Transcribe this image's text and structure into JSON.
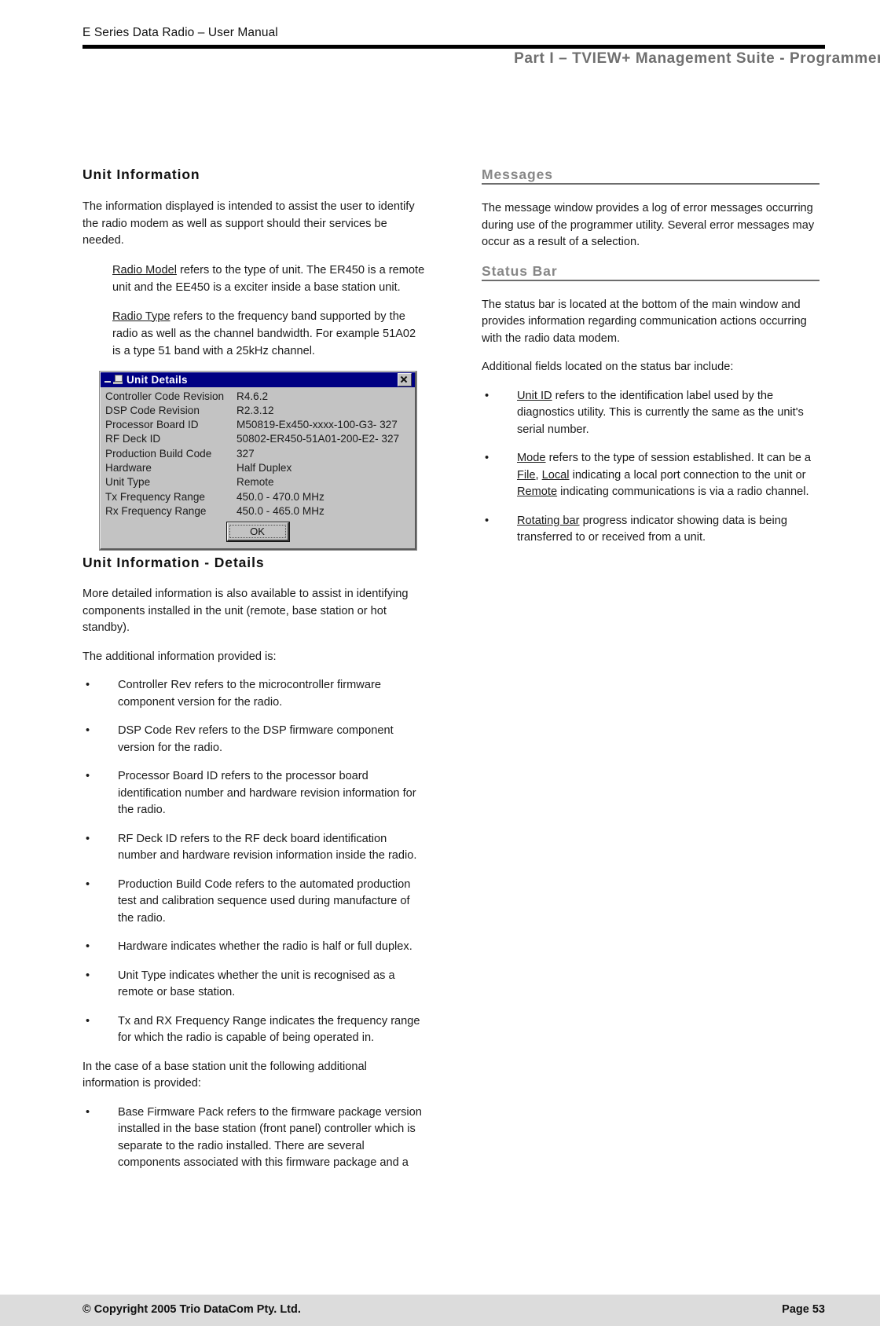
{
  "header": {
    "running_title": "E Series Data Radio – User Manual",
    "part_title": "Part I – TVIEW+ Management Suite - Programmer"
  },
  "left_column": {
    "section1_title": "Unit Information",
    "section1_intro": "The information displayed is intended to assist the user to identify the radio modem as well as support should their services be needed.",
    "def_radio_model_term": "Radio Model",
    "def_radio_model_text": " refers to the type of unit. The ER450 is a remote unit and the EE450 is a exciter inside a base station unit.",
    "def_radio_type_term": "Radio Type",
    "def_radio_type_text": " refers to the frequency band supported by the radio as well as the channel bandwidth. For example 51A02 is a type 51 band with a 25kHz channel.",
    "section2_title": "Unit Information - Details",
    "section2_para1": "More detailed information is also available to assist in identifying components installed in the unit (remote, base station or hot standby).",
    "section2_para2": "The additional information provided is:",
    "details_bullets": [
      "Controller Rev refers to the microcontroller firmware component version for the radio.",
      "DSP Code Rev refers to the DSP firmware component version for the radio.",
      "Processor Board ID refers to the processor board identification number and hardware revision information for the radio.",
      "RF Deck ID refers to the RF deck board identification number and hardware revision information inside the radio.",
      "Production Build Code refers to the automated production test and calibration sequence used during manufacture of the radio.",
      "Hardware indicates whether the radio is half or full duplex.",
      "Unit Type indicates whether the unit is recognised as a remote or base station.",
      "Tx and RX  Frequency Range indicates the frequency range for which the radio is capable of being operated in."
    ],
    "base_station_lead": "In the case of a base station unit the following additional information is provided:",
    "base_station_bullets": [
      "Base Firmware Pack refers to the firmware package version installed in the base station (front panel) controller which is separate to the radio installed. There are several components associated with this firmware package and a"
    ]
  },
  "dialog": {
    "title": "Unit Details",
    "minimize_icon": "minimize-icon",
    "app_icon": "app-icon",
    "close_icon": "close-icon",
    "rows": [
      {
        "label": "Controller Code Revision",
        "value": "R4.6.2"
      },
      {
        "label": "DSP Code Revision",
        "value": "R2.3.12"
      },
      {
        "label": "Processor Board ID",
        "value": "M50819-Ex450-xxxx-100-G3- 327"
      },
      {
        "label": "RF Deck ID",
        "value": "50802-ER450-51A01-200-E2- 327"
      },
      {
        "label": "Production Build Code",
        "value": "327"
      },
      {
        "label": "Hardware",
        "value": "Half Duplex"
      },
      {
        "label": "Unit Type",
        "value": "Remote"
      },
      {
        "label": "Tx Frequency Range",
        "value": "450.0 - 470.0 MHz"
      },
      {
        "label": "Rx Frequency Range",
        "value": "450.0 - 465.0 MHz"
      }
    ],
    "ok_label": "OK"
  },
  "right_column": {
    "messages_title": "Messages",
    "messages_para": "The message window provides a log of error messages occurring during use of the programmer utility. Several error messages may occur as a result of a selection.",
    "status_bar_title": "Status Bar",
    "status_bar_para1": "The status bar is located at the bottom of the main window and provides information regarding communication actions occurring with the radio data modem.",
    "status_bar_para2": "Additional fields located on the status bar include:",
    "bullet_unit_id_term": "Unit ID",
    "bullet_unit_id_text": " refers to the identification label used by the diagnostics utility. This is currently the same as the unit's serial number.",
    "bullet_mode_term": "Mode",
    "bullet_mode_text_1": " refers to the type of session established. It can be a ",
    "bullet_mode_term_file": "File",
    "bullet_mode_sep": ", ",
    "bullet_mode_term_local": "Local",
    "bullet_mode_text_2": " indicating a local port connection to the unit or ",
    "bullet_mode_term_remote": "Remote",
    "bullet_mode_text_3": " indicating communications is via a radio channel.",
    "bullet_rotating_term": "Rotating bar",
    "bullet_rotating_text": " progress indicator showing data is being transferred to or received from a unit."
  },
  "footer": {
    "copyright": "© Copyright 2005 Trio DataCom Pty. Ltd.",
    "page": "Page 53"
  },
  "colors": {
    "header_rule": "#000000",
    "part_title": "#6f6f6f",
    "gray_heading": "#868686",
    "dialog_titlebar": "#000083",
    "dialog_face": "#c3c3c3",
    "footer_band": "#dcdcdc"
  }
}
